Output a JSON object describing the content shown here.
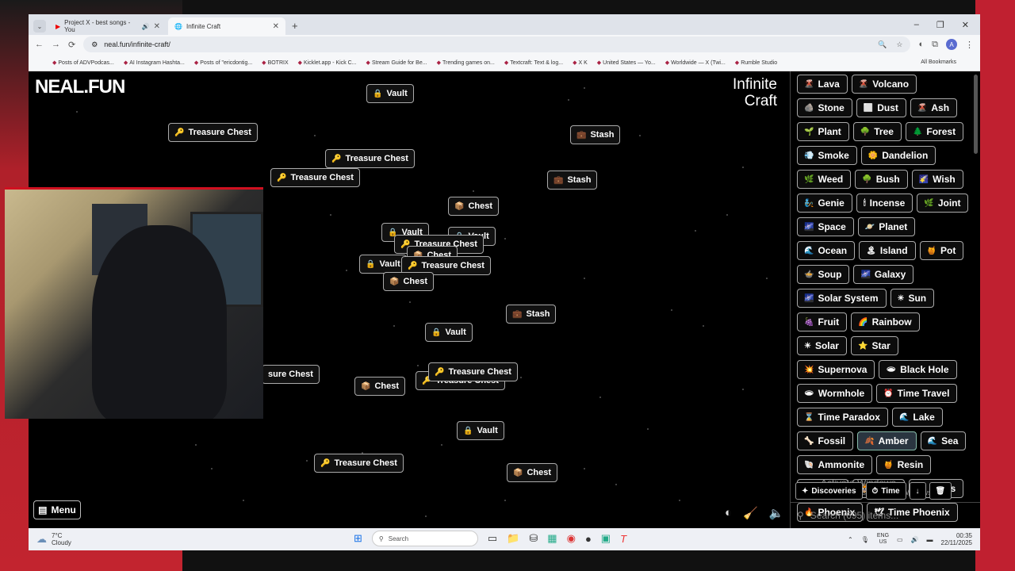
{
  "browser": {
    "tabs": [
      {
        "title": "Project X - best songs - You",
        "active": false
      },
      {
        "title": "Infinite Craft",
        "active": true
      }
    ],
    "url": "neal.fun/infinite-craft/",
    "bookmarks": [
      "Posts of ADVPodcas...",
      "AI Instagram Hashta...",
      "Posts of \"ericdontig...",
      "BOTRIX",
      "Kicklet.app - Kick C...",
      "Stream Guide for Be...",
      "Trending games on...",
      "Textcraft: Text & log...",
      "X K",
      "United States — Yo...",
      "Worldwide — X (Twi...",
      "Rumble Studio"
    ],
    "all_bookmarks": "All Bookmarks"
  },
  "page": {
    "site_logo": "NEAL.FUN",
    "game_logo_line1": "Infinite",
    "game_logo_line2": "Craft",
    "menu_label": "Menu"
  },
  "canvas_chips": [
    {
      "label": "Vault",
      "emoji": "🔒"
    },
    {
      "label": "Treasure Chest",
      "emoji": "🔑"
    },
    {
      "label": "Stash",
      "emoji": "💼"
    },
    {
      "label": "Treasure Chest",
      "emoji": "🔑"
    },
    {
      "label": "Treasure Chest",
      "emoji": "🔑"
    },
    {
      "label": "Stash",
      "emoji": "💼"
    },
    {
      "label": "Chest",
      "emoji": "📦"
    },
    {
      "label": "Vault",
      "emoji": "🔒"
    },
    {
      "label": "Vault",
      "emoji": "🔒"
    },
    {
      "label": "Treasure Chest",
      "emoji": "🔑"
    },
    {
      "label": "Chest",
      "emoji": "📦"
    },
    {
      "label": "Vault",
      "emoji": "🔒"
    },
    {
      "label": "Treasure Chest",
      "emoji": "🔑"
    },
    {
      "label": "Chest",
      "emoji": "📦"
    },
    {
      "label": "Stash",
      "emoji": "💼"
    },
    {
      "label": "Vault",
      "emoji": "🔒"
    },
    {
      "label": "sure Chest",
      "emoji": ""
    },
    {
      "label": "Chest",
      "emoji": "📦"
    },
    {
      "label": "Treasure Chest",
      "emoji": "🔑"
    },
    {
      "label": "Treasure Chest",
      "emoji": "🔑"
    },
    {
      "label": "Vault",
      "emoji": "🔒"
    },
    {
      "label": "Treasure Chest",
      "emoji": "🔑"
    },
    {
      "label": "Chest",
      "emoji": "📦"
    }
  ],
  "sidebar": {
    "items": [
      {
        "label": "Lava",
        "emoji": "🌋"
      },
      {
        "label": "Volcano",
        "emoji": "🌋"
      },
      {
        "label": "Stone",
        "emoji": "🪨"
      },
      {
        "label": "Dust",
        "emoji": "⬜"
      },
      {
        "label": "Ash",
        "emoji": "🌋"
      },
      {
        "label": "Plant",
        "emoji": "🌱"
      },
      {
        "label": "Tree",
        "emoji": "🌳"
      },
      {
        "label": "Forest",
        "emoji": "🌲"
      },
      {
        "label": "Smoke",
        "emoji": "💨"
      },
      {
        "label": "Dandelion",
        "emoji": "🌼"
      },
      {
        "label": "Weed",
        "emoji": "🌿"
      },
      {
        "label": "Bush",
        "emoji": "🌳"
      },
      {
        "label": "Wish",
        "emoji": "🌠"
      },
      {
        "label": "Genie",
        "emoji": "🧞"
      },
      {
        "label": "Incense",
        "emoji": "🕯"
      },
      {
        "label": "Joint",
        "emoji": "🌿"
      },
      {
        "label": "Space",
        "emoji": "🌌"
      },
      {
        "label": "Planet",
        "emoji": "🪐"
      },
      {
        "label": "Ocean",
        "emoji": "🌊"
      },
      {
        "label": "Island",
        "emoji": "🏝"
      },
      {
        "label": "Pot",
        "emoji": "🍯"
      },
      {
        "label": "Soup",
        "emoji": "🍲"
      },
      {
        "label": "Galaxy",
        "emoji": "🌌"
      },
      {
        "label": "Solar System",
        "emoji": "🌌"
      },
      {
        "label": "Sun",
        "emoji": "☀"
      },
      {
        "label": "Fruit",
        "emoji": "🍇"
      },
      {
        "label": "Rainbow",
        "emoji": "🌈"
      },
      {
        "label": "Solar",
        "emoji": "☀"
      },
      {
        "label": "Star",
        "emoji": "⭐"
      },
      {
        "label": "Supernova",
        "emoji": "💥"
      },
      {
        "label": "Black Hole",
        "emoji": "🕳"
      },
      {
        "label": "Wormhole",
        "emoji": "🕳"
      },
      {
        "label": "Time Travel",
        "emoji": "⏰"
      },
      {
        "label": "Time Paradox",
        "emoji": "⌛"
      },
      {
        "label": "Lake",
        "emoji": "🌊"
      },
      {
        "label": "Fossil",
        "emoji": "🦴"
      },
      {
        "label": "Amber",
        "emoji": "🍂"
      },
      {
        "label": "Sea",
        "emoji": "🌊"
      },
      {
        "label": "Ammonite",
        "emoji": "🐚"
      },
      {
        "label": "Resin",
        "emoji": "🍯"
      },
      {
        "label": "Palm",
        "emoji": "🌴"
      },
      {
        "label": "Tiger",
        "emoji": "🐯"
      },
      {
        "label": "Oasis",
        "emoji": "🏝"
      },
      {
        "label": "Phoenix",
        "emoji": "🔥"
      },
      {
        "label": "Time Phoenix",
        "emoji": "🕊"
      }
    ],
    "selected": "Amber",
    "discoveries_label": "Discoveries",
    "time_label": "Time",
    "search_placeholder": "Search (695) items...",
    "watermark_line1": "Activate Windows",
    "watermark_line2": "Go to Settings to activate Windows."
  },
  "taskbar": {
    "temp": "7°C",
    "weather": "Cloudy",
    "search_placeholder": "Search",
    "lang_line1": "ENG",
    "lang_line2": "US",
    "time": "00:35",
    "date": "22/11/2025"
  }
}
